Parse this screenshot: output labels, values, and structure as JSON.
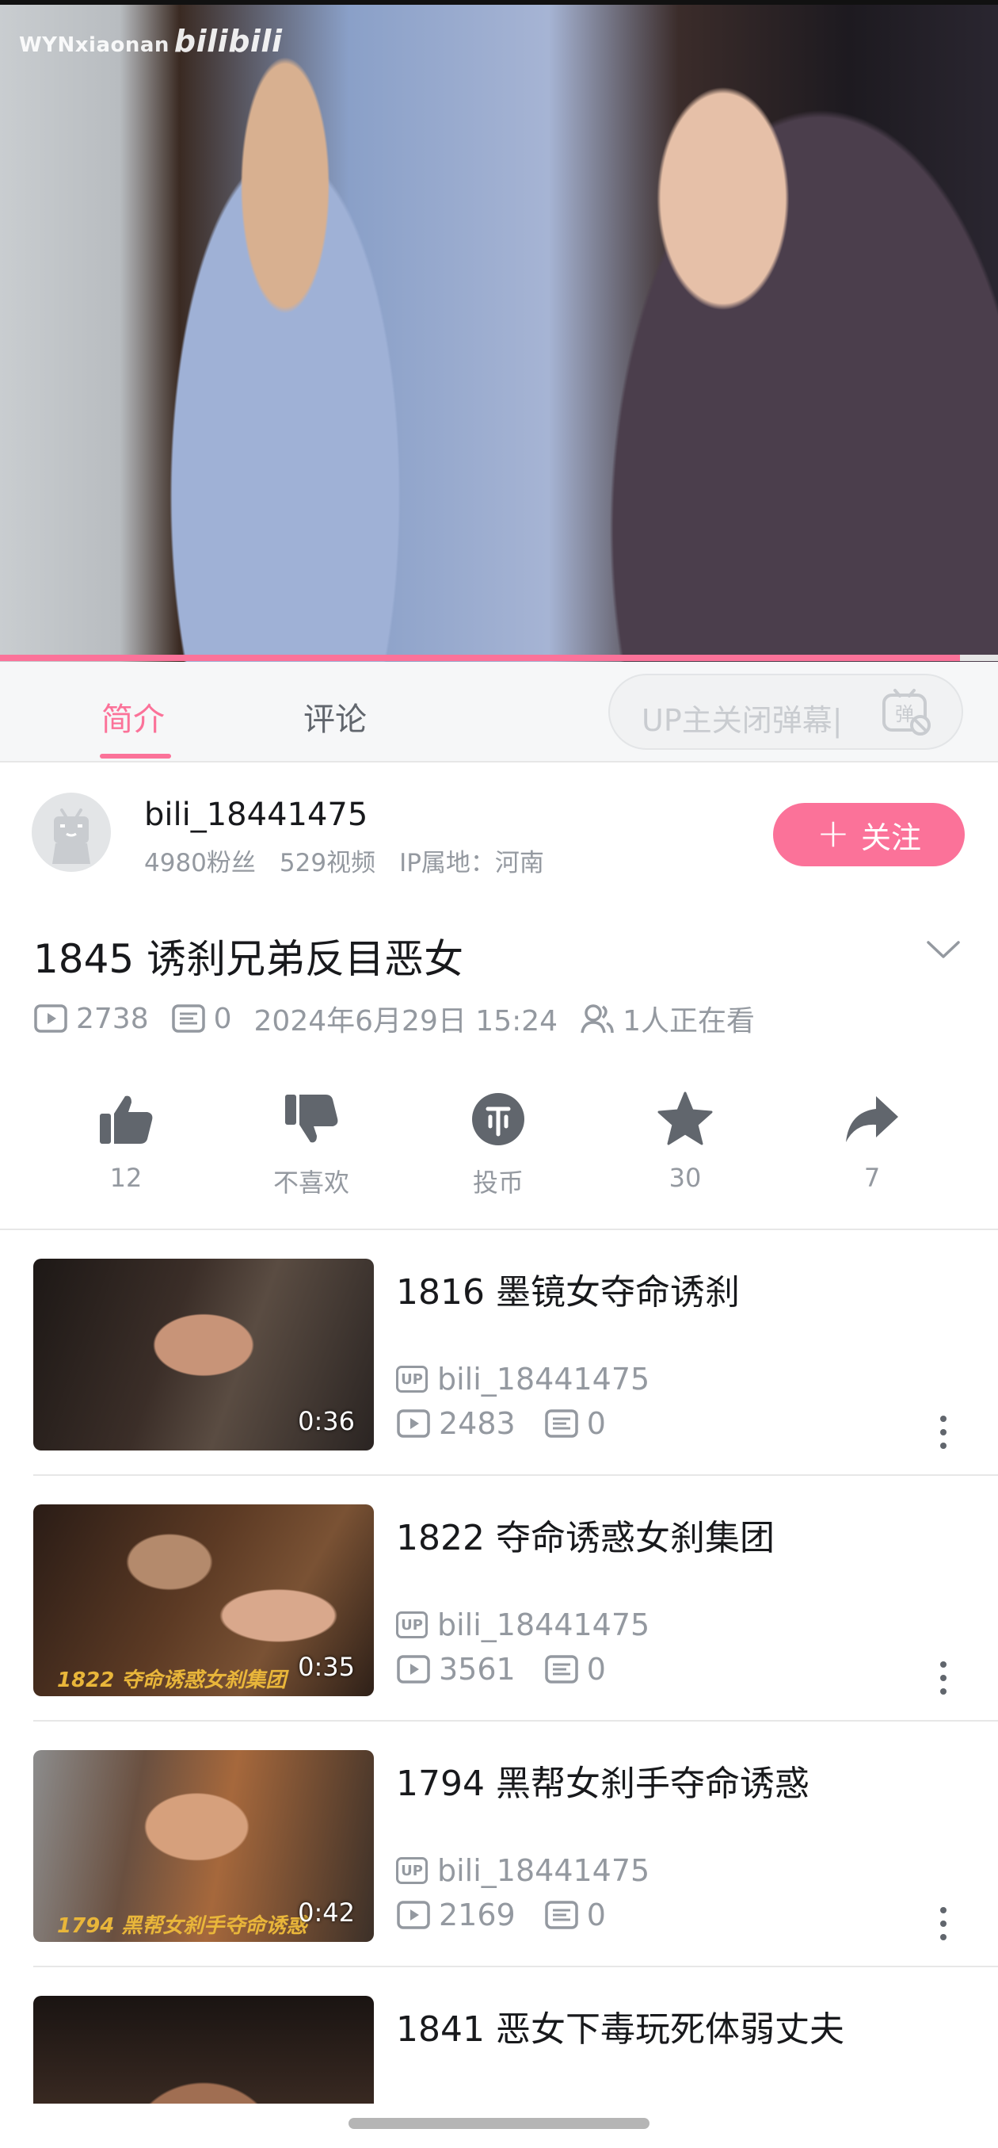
{
  "video": {
    "watermark_user": "WYNxiaonan",
    "watermark_brand": "bilibili",
    "progress_fraction": 0.962
  },
  "tabs": {
    "intro": "简介",
    "comments": "评论",
    "danmaku_placeholder": "UP主关闭弹幕|"
  },
  "uploader": {
    "name": "bili_18441475",
    "fans": "4980粉丝",
    "videos": "529视频",
    "ip": "IP属地：河南",
    "follow_label": "关注"
  },
  "detail": {
    "title": "1845 诱刹兄弟反目恶女",
    "plays": "2738",
    "danmaku_count": "0",
    "date": "2024年6月29日 15:24",
    "watching": "1人正在看"
  },
  "actions": {
    "like": "12",
    "dislike": "不喜欢",
    "coin": "投币",
    "favorite": "30",
    "share": "7"
  },
  "recommendations": [
    {
      "title": "1816 墨镜女夺命诱刹",
      "uploader": "bili_18441475",
      "plays": "2483",
      "danmaku": "0",
      "duration": "0:36",
      "caption": ""
    },
    {
      "title": "1822 夺命诱惑女刹集团",
      "uploader": "bili_18441475",
      "plays": "3561",
      "danmaku": "0",
      "duration": "0:35",
      "caption": "1822 夺命诱惑女刹集团"
    },
    {
      "title": "1794 黑帮女刹手夺命诱惑",
      "uploader": "bili_18441475",
      "plays": "2169",
      "danmaku": "0",
      "duration": "0:42",
      "caption": "1794 黑帮女刹手夺命诱惑"
    },
    {
      "title": "1841 恶女下毒玩死体弱丈夫"
    }
  ],
  "colors": {
    "accent": "#fb7299",
    "text": "#18191c",
    "muted": "#9499a0"
  }
}
